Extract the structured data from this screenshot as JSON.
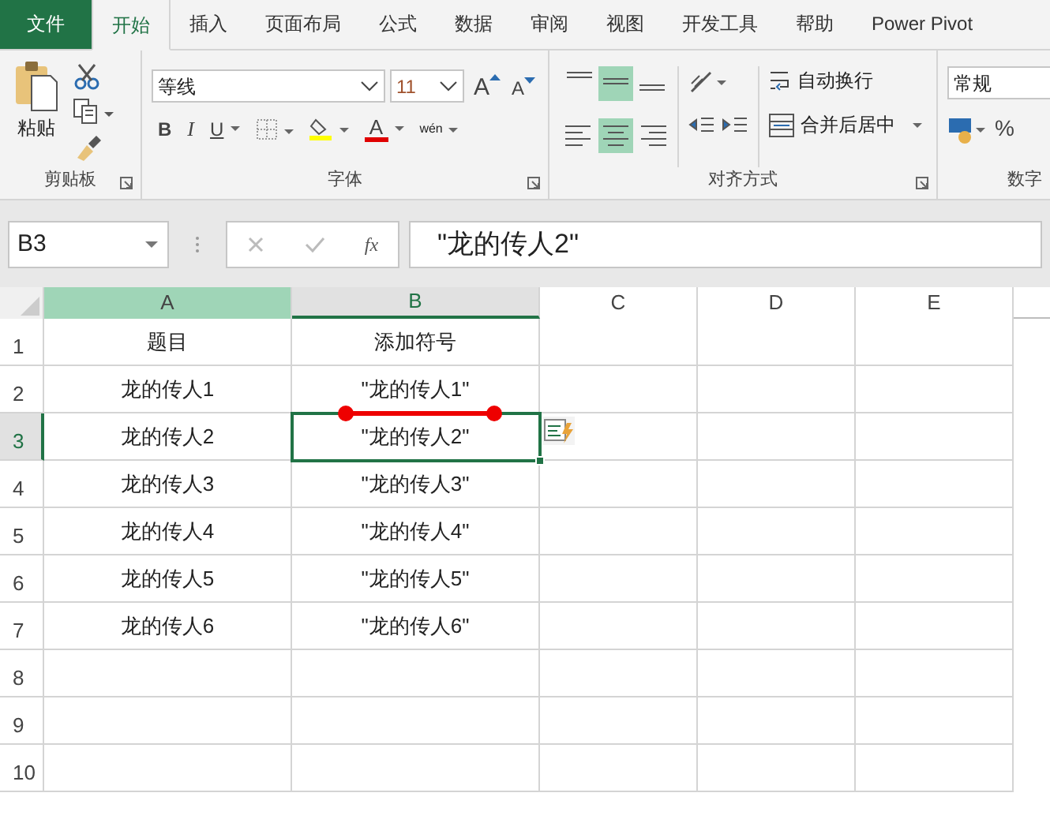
{
  "tabs": [
    {
      "label": "文件",
      "kind": "file",
      "selected": false
    },
    {
      "label": "开始",
      "kind": "tab",
      "selected": true
    },
    {
      "label": "插入",
      "kind": "tab",
      "selected": false
    },
    {
      "label": "页面布局",
      "kind": "tab",
      "selected": false
    },
    {
      "label": "公式",
      "kind": "tab",
      "selected": false
    },
    {
      "label": "数据",
      "kind": "tab",
      "selected": false
    },
    {
      "label": "审阅",
      "kind": "tab",
      "selected": false
    },
    {
      "label": "视图",
      "kind": "tab",
      "selected": false
    },
    {
      "label": "开发工具",
      "kind": "tab",
      "selected": false
    },
    {
      "label": "帮助",
      "kind": "tab",
      "selected": false
    },
    {
      "label": "Power Pivot",
      "kind": "tab",
      "selected": false
    }
  ],
  "ribbon": {
    "clipboard": {
      "paste_label": "粘贴",
      "group_label": "剪贴板"
    },
    "font": {
      "font_name": "等线",
      "font_size": "11",
      "grow_label": "A",
      "shrink_label": "A",
      "bold_label": "B",
      "italic_label": "I",
      "underline_label": "U",
      "color_label": "A",
      "phonetic_label": "wén",
      "group_label": "字体"
    },
    "alignment": {
      "wrap_label": "自动换行",
      "merge_label": "合并后居中",
      "group_label": "对齐方式"
    },
    "number": {
      "format": "常规",
      "percent": "%",
      "group_label": "数字"
    }
  },
  "formula_bar": {
    "name_box": "B3",
    "function_label": "fx",
    "formula": "\"龙的传人2\""
  },
  "columns": [
    {
      "label": "A",
      "highlighted": true,
      "selected": false
    },
    {
      "label": "B",
      "highlighted": false,
      "selected": true
    },
    {
      "label": "C",
      "highlighted": false,
      "selected": false
    },
    {
      "label": "D",
      "highlighted": false,
      "selected": false
    },
    {
      "label": "E",
      "highlighted": false,
      "selected": false
    }
  ],
  "rows": [
    {
      "label": "1",
      "selected": false,
      "cells": [
        {
          "text": "题目",
          "selected": false
        },
        {
          "text": "添加符号",
          "selected": false
        }
      ]
    },
    {
      "label": "2",
      "selected": false,
      "cells": [
        {
          "text": "龙的传人1",
          "selected": false
        },
        {
          "text": "\"龙的传人1\"",
          "selected": false
        }
      ]
    },
    {
      "label": "3",
      "selected": true,
      "cells": [
        {
          "text": "龙的传人2",
          "selected": false
        },
        {
          "text": "\"龙的传人2\"",
          "selected": true
        }
      ]
    },
    {
      "label": "4",
      "selected": false,
      "cells": [
        {
          "text": "龙的传人3",
          "selected": false
        },
        {
          "text": "\"龙的传人3\"",
          "selected": false
        }
      ]
    },
    {
      "label": "5",
      "selected": false,
      "cells": [
        {
          "text": "龙的传人4",
          "selected": false
        },
        {
          "text": "\"龙的传人4\"",
          "selected": false
        }
      ]
    },
    {
      "label": "6",
      "selected": false,
      "cells": [
        {
          "text": "龙的传人5",
          "selected": false
        },
        {
          "text": "\"龙的传人5\"",
          "selected": false
        }
      ]
    },
    {
      "label": "7",
      "selected": false,
      "cells": [
        {
          "text": "龙的传人6",
          "selected": false
        },
        {
          "text": "\"龙的传人6\"",
          "selected": false
        }
      ]
    },
    {
      "label": "8",
      "selected": false
    },
    {
      "label": "9",
      "selected": false
    },
    {
      "label": "10",
      "selected": false
    }
  ]
}
